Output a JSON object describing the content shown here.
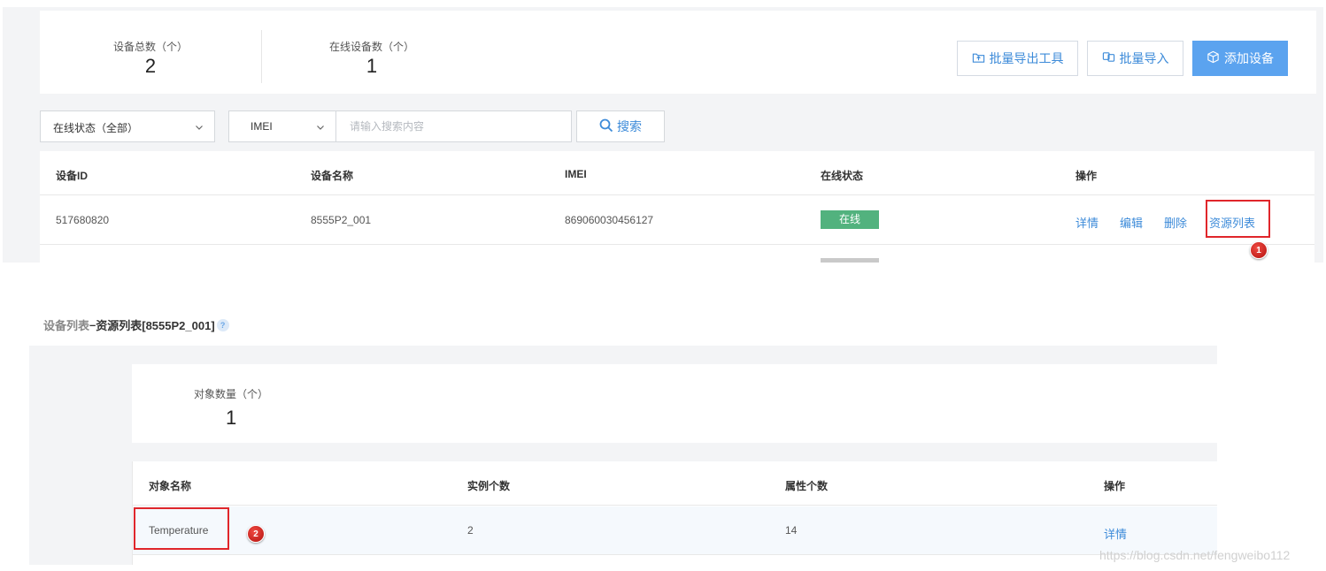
{
  "top": {
    "stats": {
      "total_label": "设备总数（个）",
      "total_value": "2",
      "online_label": "在线设备数（个）",
      "online_value": "1"
    },
    "buttons": {
      "export": "批量导出工具",
      "import": "批量导入",
      "add": "添加设备"
    },
    "filters": {
      "status_selected": "在线状态（全部）",
      "search_type_selected": "IMEI",
      "search_placeholder": "请输入搜索内容",
      "search_button": "搜索"
    },
    "device_table": {
      "columns": [
        "设备ID",
        "设备名称",
        "IMEI",
        "在线状态",
        "操作"
      ],
      "rows": [
        {
          "id": "517680820",
          "name": "8555P2_001",
          "imei": "869060030456127",
          "status": "在线",
          "actions": [
            "详情",
            "编辑",
            "删除",
            "资源列表"
          ]
        }
      ]
    },
    "markers": [
      "1",
      "2"
    ]
  },
  "bottom": {
    "breadcrumb": {
      "parent": "设备列表",
      "separator": " – ",
      "current": "资源列表[8555P2_001]",
      "help": "?"
    },
    "object_stat": {
      "label": "对象数量（个）",
      "value": "1"
    },
    "object_table": {
      "columns": [
        "对象名称",
        "实例个数",
        "属性个数",
        "操作"
      ],
      "rows": [
        {
          "name": "Temperature",
          "instances": "2",
          "attributes": "14",
          "action": "详情"
        }
      ]
    }
  },
  "watermark": "https://blog.csdn.net/fengweibo112",
  "colors": {
    "accent": "#3d8bd9",
    "primary_button": "#5ba3ef",
    "online_tag": "#52b27e",
    "highlight_box": "#e0262b",
    "panel_background": "#f3f4f6"
  },
  "icons": [
    "export-icon",
    "import-icon",
    "cube-icon",
    "search-icon",
    "chevron-down-icon",
    "help-icon"
  ]
}
